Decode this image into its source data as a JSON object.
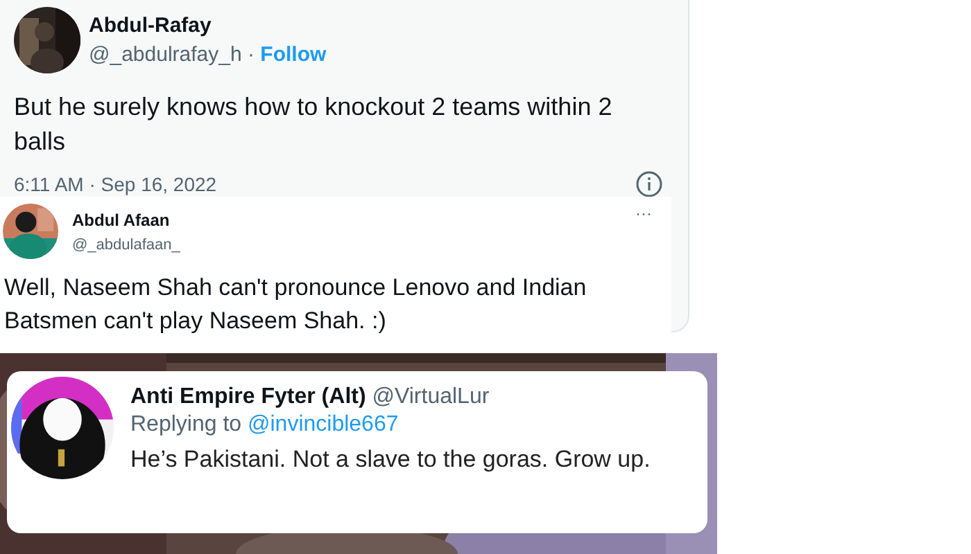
{
  "tweets": [
    {
      "kind": "detail",
      "name": "Abdul-Rafay",
      "handle": "@_abdulrafay_h",
      "separator": "·",
      "follow": "Follow",
      "text": "But he surely knows how to knockout 2 teams within 2 balls",
      "timestamp": "6:11 AM · Sep 16, 2022"
    },
    {
      "kind": "compact",
      "name": "Abdul Afaan",
      "handle": "@_abdulafaan_",
      "more": "···",
      "text": "Well, Naseem Shah can't pronounce Lenovo and Indian Batsmen can't play Naseem Shah. :)"
    },
    {
      "kind": "reply",
      "name": "Anti Empire Fyter (Alt)",
      "handle": "@VirtualLur",
      "replying_label": "Replying to",
      "mention": "@invincible667",
      "text": "He’s Pakistani. Not a slave to the goras. Grow up."
    }
  ]
}
